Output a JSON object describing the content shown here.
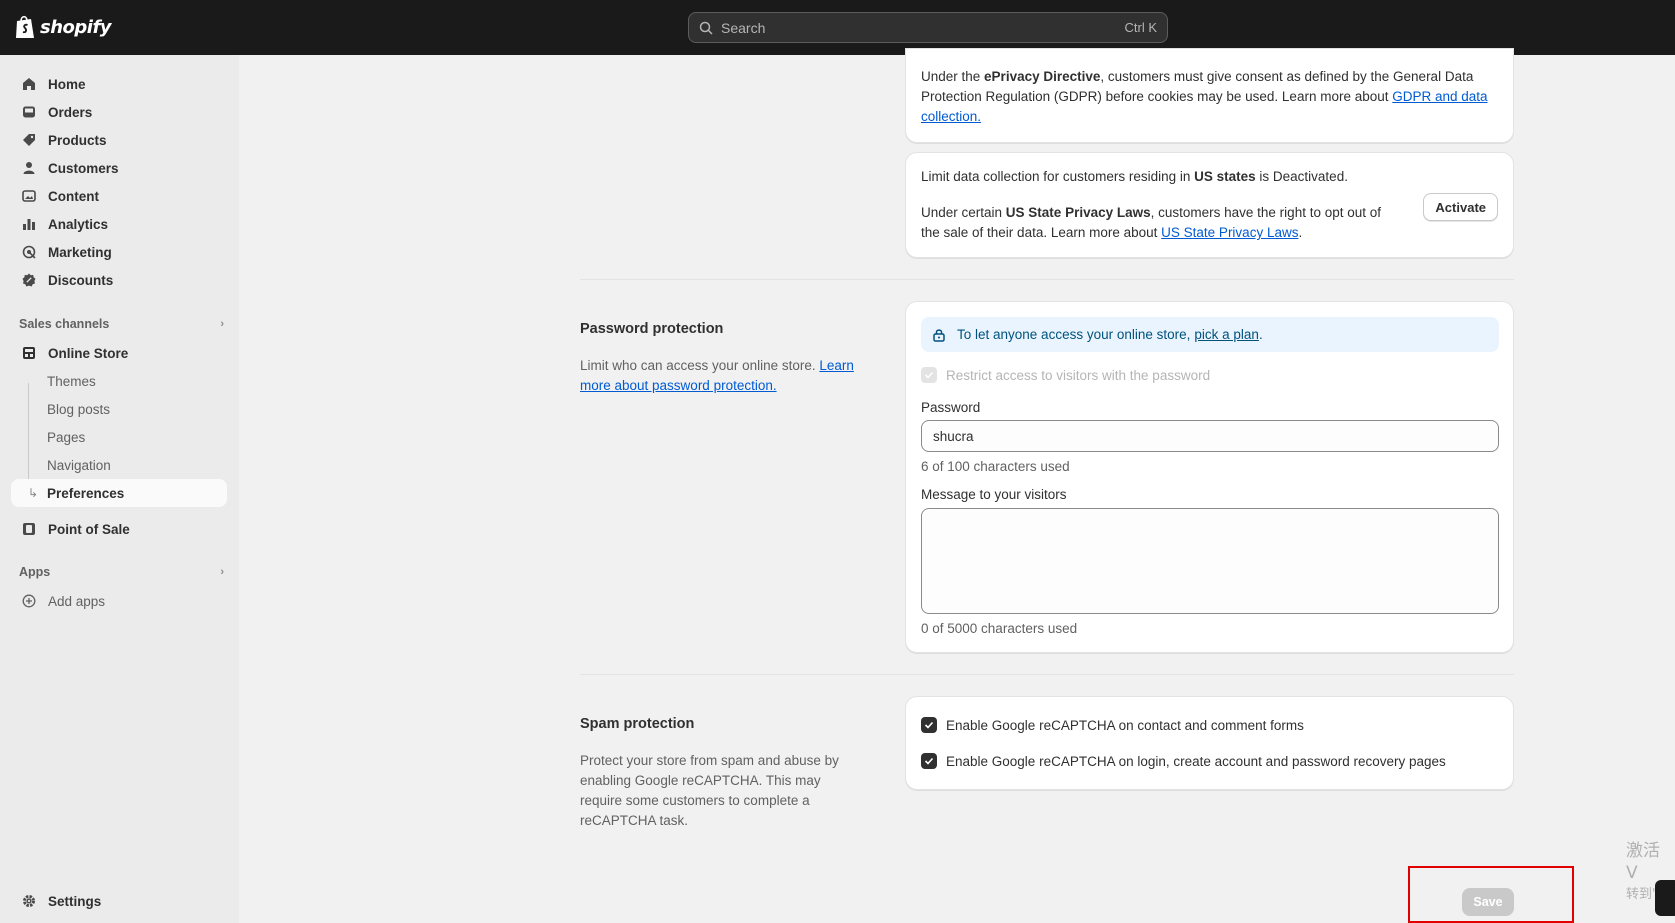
{
  "topbar": {
    "brand": "shopify",
    "search_placeholder": "Search",
    "search_shortcut": "Ctrl K"
  },
  "sidebar": {
    "main_items": [
      {
        "label": "Home",
        "icon": "home-icon"
      },
      {
        "label": "Orders",
        "icon": "inbox-icon"
      },
      {
        "label": "Products",
        "icon": "tag-icon"
      },
      {
        "label": "Customers",
        "icon": "person-icon"
      },
      {
        "label": "Content",
        "icon": "image-icon"
      },
      {
        "label": "Analytics",
        "icon": "bar-chart-icon"
      },
      {
        "label": "Marketing",
        "icon": "target-icon"
      },
      {
        "label": "Discounts",
        "icon": "discount-icon"
      }
    ],
    "sales_channels_header": "Sales channels",
    "online_store": "Online Store",
    "online_store_sub": [
      "Themes",
      "Blog posts",
      "Pages",
      "Navigation",
      "Preferences"
    ],
    "point_of_sale": "Point of Sale",
    "apps_header": "Apps",
    "add_apps": "Add apps",
    "settings": "Settings"
  },
  "privacy": {
    "eprivacy_prefix": "Under the ",
    "eprivacy_bold": "ePrivacy Directive",
    "eprivacy_rest": ", customers must give consent as defined by the General Data Protection Regulation (GDPR) before cookies may be used. Learn more about ",
    "eprivacy_link": "GDPR and data collection.",
    "us_line_prefix": "Limit data collection for customers residing in ",
    "us_line_bold": "US states",
    "us_line_rest": " is Deactivated.",
    "us_law_prefix": "Under certain ",
    "us_law_bold": "US State Privacy Laws",
    "us_law_rest": ", customers have the right to opt out of the sale of their data. Learn more about ",
    "us_law_link": "US State Privacy Laws",
    "us_law_end": ".",
    "activate_label": "Activate"
  },
  "password_protection": {
    "title": "Password protection",
    "desc_prefix": "Limit who can access your online store. ",
    "desc_link": "Learn more about password protection.",
    "banner_prefix": "To let anyone access your online store, ",
    "banner_link": "pick a plan",
    "banner_end": ".",
    "restrict_label": "Restrict access to visitors with the password",
    "password_label": "Password",
    "password_value": "shucra",
    "password_help": "6 of 100 characters used",
    "message_label": "Message to your visitors",
    "message_help": "0 of 5000 characters used"
  },
  "spam_protection": {
    "title": "Spam protection",
    "desc": "Protect your store from spam and abuse by enabling Google reCAPTCHA. This may require some customers to complete a reCAPTCHA task.",
    "option1": "Enable Google reCAPTCHA on contact and comment forms",
    "option2": "Enable Google reCAPTCHA on login, create account and password recovery pages"
  },
  "footer": {
    "save_label": "Save"
  },
  "watermark": {
    "line1": "激活 V",
    "line2": "转到\"设"
  },
  "colors": {
    "topbar": "#1a1a1a",
    "link": "#005bd3",
    "banner_bg": "#eaf4ff",
    "highlight": "#e00000"
  }
}
